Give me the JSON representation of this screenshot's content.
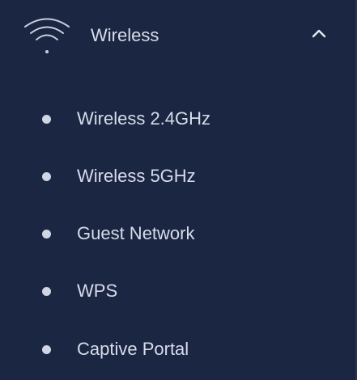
{
  "colors": {
    "background": "#1b2742",
    "text": "#d7dcea",
    "bullet": "#cfd5e3"
  },
  "menu": {
    "group_icon": "wifi-icon",
    "group_label": "Wireless",
    "expanded": true,
    "toggle_icon": "chevron-up-icon",
    "items": [
      {
        "label": "Wireless 2.4GHz"
      },
      {
        "label": "Wireless 5GHz"
      },
      {
        "label": "Guest Network"
      },
      {
        "label": "WPS"
      },
      {
        "label": "Captive Portal"
      }
    ]
  }
}
